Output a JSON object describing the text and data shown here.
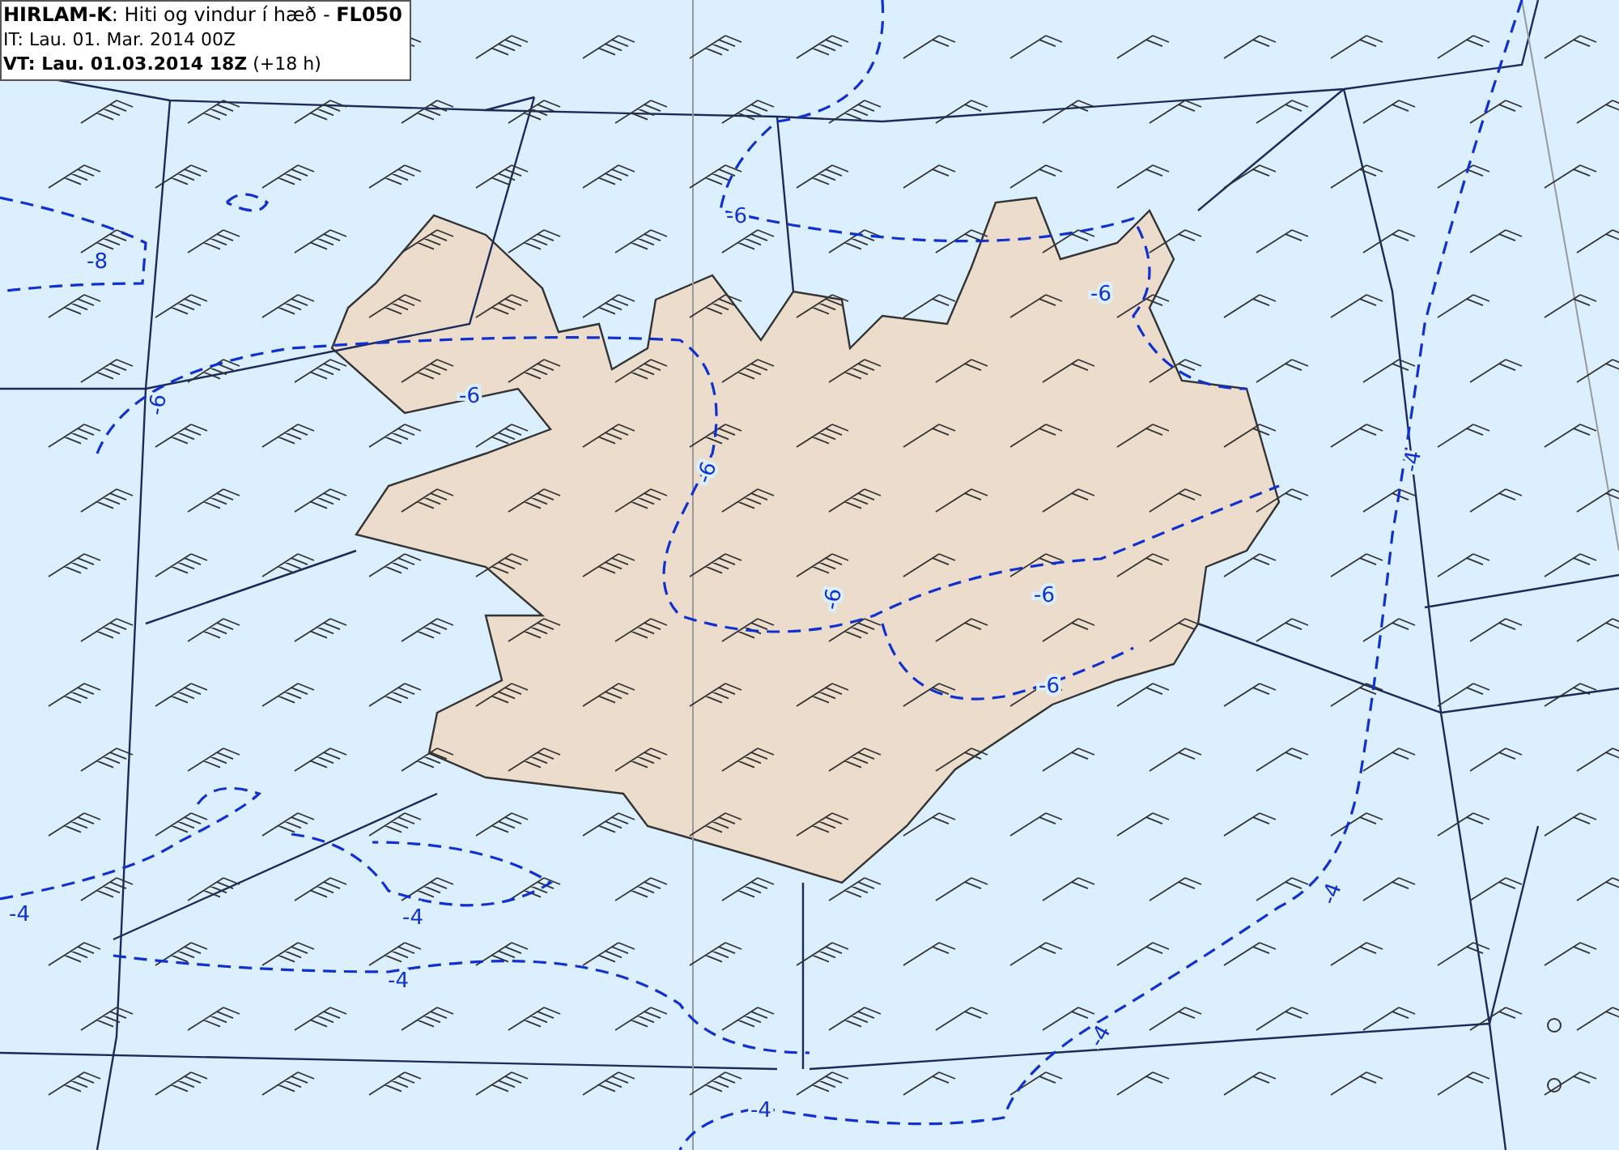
{
  "header": {
    "lines": [
      "**HIRLAM-K**: Hiti og vindur í hæð - **FL050**",
      "IT: Lau. 01. Mar. 2014 00Z",
      "**VT: Lau. 01.03.2014 18Z** (+18 h)"
    ]
  },
  "contour_labels": [
    "-8",
    "-6",
    "-6",
    "-6",
    "-6",
    "-6",
    "-6",
    "-6",
    "-6",
    "-4",
    "-4",
    "-4",
    "-4",
    "-4",
    "-4",
    "-4"
  ]
}
